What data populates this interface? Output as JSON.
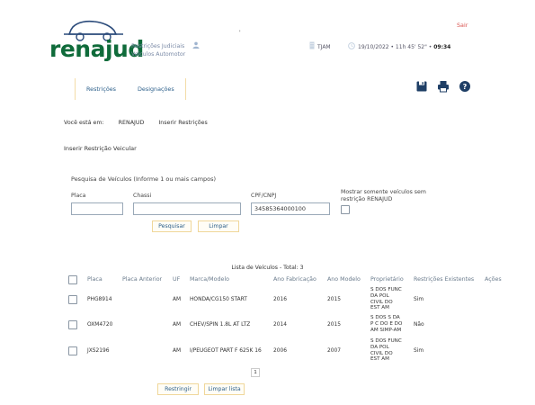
{
  "header": {
    "logo_text": "renajud",
    "tagline": [
      "Restrições Judiciais",
      "Veículos Automotor"
    ],
    "tiny_mark": "'",
    "org": "TJAM",
    "datetime_prefix": "19/10/2022 • 11h 45' 52\" •",
    "datetime_time": "09:34",
    "logout_label": "Sair"
  },
  "nav": {
    "items": [
      {
        "label": "Restrições"
      },
      {
        "label": "Designações"
      }
    ]
  },
  "breadcrumb": {
    "prefix": "Você está em:",
    "items": [
      "RENAJUD",
      "Inserir Restrições"
    ]
  },
  "page_title": "Inserir Restrição Veicular",
  "search": {
    "title": "Pesquisa de Veículos (Informe 1 ou mais campos)",
    "placa_label": "Placa",
    "placa_value": "",
    "chassi_label": "Chassi",
    "chassi_value": "",
    "cpf_label": "CPF/CNPJ",
    "cpf_value": "34585364000100",
    "mostrar_label": [
      "Mostrar somente veículos sem",
      "restrição RENAJUD"
    ],
    "pesquisar_label": "Pesquisar",
    "limpar_label": "Limpar"
  },
  "list": {
    "title": "Lista de Veículos - Total: 3",
    "headers": [
      "Placa",
      "Placa Anterior",
      "UF",
      "Marca/Modelo",
      "Ano Fabricação",
      "Ano Modelo",
      "Proprietário",
      "Restrições Existentes",
      "Ações"
    ],
    "rows": [
      {
        "placa": "PHG8914",
        "placa_anterior": "",
        "uf": "AM",
        "marca": "HONDA/CG150 START",
        "ano_fab": "2016",
        "ano_mod": "2015",
        "proprietario": [
          "S DOS FUNC",
          "DA POL",
          "CIVIL DO",
          "EST AM"
        ],
        "restricoes": "Sim"
      },
      {
        "placa": "OXM4720",
        "placa_anterior": "",
        "uf": "AM",
        "marca": "CHEV/SPIN 1.8L AT LTZ",
        "ano_fab": "2014",
        "ano_mod": "2015",
        "proprietario": [
          "S DOS S DA",
          "P C DO E DO",
          "AM SIMP-AM"
        ],
        "restricoes": "Não"
      },
      {
        "placa": "JXS2196",
        "placa_anterior": "",
        "uf": "AM",
        "marca": "I/PEUGEOT PART F 625K 16",
        "ano_fab": "2006",
        "ano_mod": "2007",
        "proprietario": [
          "S DOS FUNC",
          "DA POL",
          "CIVIL DO",
          "EST AM"
        ],
        "restricoes": "Sim"
      }
    ],
    "page_number": "1",
    "restringir_label": "Restringir",
    "limpar_lista_label": "Limpar lista"
  },
  "colors": {
    "brand_green": "#0f6b3a",
    "link_blue": "#2c5f8a",
    "button_border": "#f0d79a",
    "logout_red": "#d9534f",
    "icon_blue": "#1f3f66"
  },
  "icons": [
    "car-logo-icon",
    "user-icon",
    "building-icon",
    "clock-icon",
    "save-icon",
    "print-icon",
    "help-icon"
  ]
}
